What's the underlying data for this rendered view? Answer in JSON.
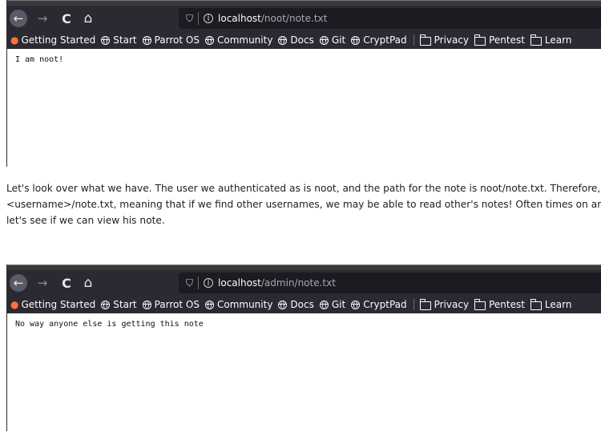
{
  "browser1": {
    "url_host": "localhost",
    "url_path": "/noot/note.txt",
    "page_text": "I am noot!"
  },
  "browser2": {
    "url_host": "localhost",
    "url_path": "/admin/note.txt",
    "page_text": "No way anyone else is getting this note"
  },
  "nav_icons": {
    "back": "←",
    "forward": "→",
    "reload": "C",
    "home": "⌂",
    "shield": "⛉",
    "info": "i"
  },
  "bookmarks": [
    {
      "label": "Getting Started",
      "icon": "firefox-icon"
    },
    {
      "label": "Start",
      "icon": "globe-icon"
    },
    {
      "label": "Parrot OS",
      "icon": "globe-icon"
    },
    {
      "label": "Community",
      "icon": "globe-icon"
    },
    {
      "label": "Docs",
      "icon": "globe-icon"
    },
    {
      "label": "Git",
      "icon": "globe-icon"
    },
    {
      "label": "CryptPad",
      "icon": "globe-icon"
    },
    {
      "label": "Privacy",
      "icon": "folder-icon"
    },
    {
      "label": "Pentest",
      "icon": "folder-icon"
    },
    {
      "label": "Learn",
      "icon": "folder-icon"
    }
  ],
  "prose": {
    "line1": "Let's look over what we have. The user we authenticated as is noot, and the path for the note is noot/note.txt. Therefore,",
    "line2": "<username>/note.txt, meaning that if we find other usernames, we may be able to read other's notes! Often times on any",
    "line3": "let's see if we can view his note."
  }
}
